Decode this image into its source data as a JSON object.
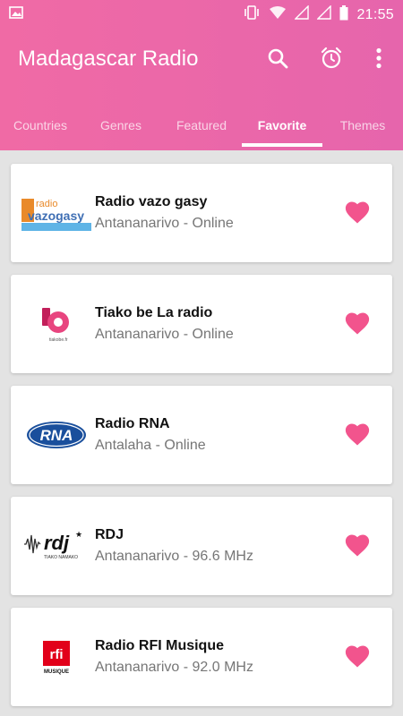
{
  "status": {
    "time": "21:55"
  },
  "app": {
    "title": "Madagascar Radio"
  },
  "toolbar": {
    "icons": [
      "search-icon",
      "alarm-clock-icon",
      "more-vert-icon"
    ]
  },
  "tabs": [
    {
      "label": "Countries",
      "active": false
    },
    {
      "label": "Genres",
      "active": false
    },
    {
      "label": "Featured",
      "active": false
    },
    {
      "label": "Favorite",
      "active": true
    },
    {
      "label": "Themes",
      "active": false
    }
  ],
  "stations": [
    {
      "name": "Radio vazo gasy",
      "subtitle": "Antananarivo - Online",
      "logo_text": "radio",
      "logo_text2": "vazogasy",
      "favorite": true
    },
    {
      "name": "Tiako be La radio",
      "subtitle": "Antananarivo - Online",
      "logo_text": "b",
      "favorite": true
    },
    {
      "name": "Radio RNA",
      "subtitle": "Antalaha - Online",
      "logo_text": "RNA",
      "favorite": true
    },
    {
      "name": "RDJ",
      "subtitle": "Antananarivo - 96.6 MHz",
      "logo_text": "rdj",
      "logo_text2": "TIAKO NAMAKO",
      "favorite": true
    },
    {
      "name": "Radio RFI Musique",
      "subtitle": "Antananarivo - 92.0 MHz",
      "logo_text": "rfi",
      "logo_text2": "MUSIQUE",
      "favorite": true
    }
  ],
  "colors": {
    "accent": "#f06aa5",
    "heart": "#f2548d",
    "background": "#e3e3e3"
  }
}
